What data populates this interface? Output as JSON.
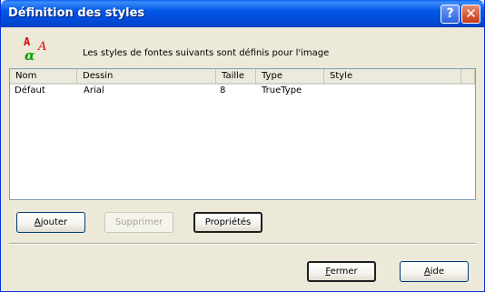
{
  "window": {
    "title": "Définition des styles"
  },
  "titlebar": {
    "help_glyph": "?",
    "close_glyph": "✕"
  },
  "header": {
    "logo_letters": [
      "A",
      "A",
      "α"
    ],
    "intro_text": "Les styles de fontes suivants sont définis pour l'image"
  },
  "list": {
    "columns": [
      "Nom",
      "Dessin",
      "Taille",
      "Type",
      "Style"
    ],
    "rows": [
      {
        "nom": "Défaut",
        "dessin": "Arial",
        "taille": "8",
        "type": "TrueType",
        "style": ""
      }
    ]
  },
  "buttons": {
    "add": {
      "accel": "A",
      "rest": "jouter",
      "enabled": true
    },
    "delete": {
      "label": "Supprimer",
      "enabled": false
    },
    "properties": {
      "label": "Propriétés",
      "enabled": true
    },
    "close": {
      "accel": "F",
      "rest": "ermer"
    },
    "help": {
      "accel": "A",
      "rest": "ide"
    }
  },
  "colors": {
    "title_bar": "#0148d4",
    "logo_red": "#e00000",
    "logo_green": "#00a000"
  }
}
